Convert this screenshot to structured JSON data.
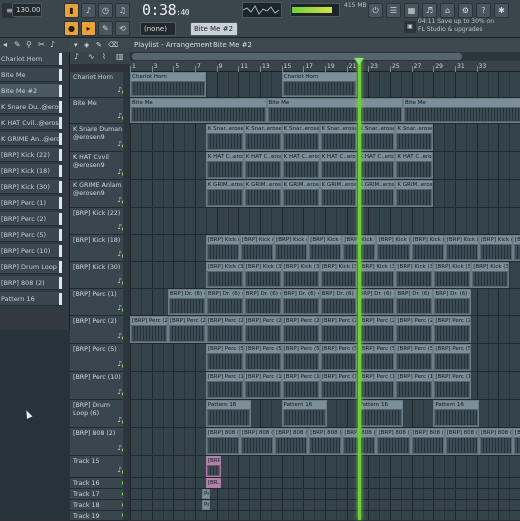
{
  "toolbar": {
    "tempo": "130.000",
    "time_main": "0:38",
    "time_sub": ":40",
    "pattern_selector": "Bite Me #2",
    "snap_selector": "(none)",
    "cpu_label": "415 MB",
    "promo_line1": "04:11  Save up to 30% on",
    "promo_line2": "FL Studio & upgrades"
  },
  "browser": {
    "items": [
      {
        "label": "Chariot Horn",
        "selected": false
      },
      {
        "label": "Bite Me",
        "selected": false
      },
      {
        "label": "Bite Me #2",
        "selected": true
      },
      {
        "label": "K Snare Du..@erosen9",
        "selected": false
      },
      {
        "label": "K HAT Cvil..@erosen9",
        "selected": false
      },
      {
        "label": "K GRIME An..@erosen9",
        "selected": false
      },
      {
        "label": "[BRP] Kick (22)",
        "selected": false
      },
      {
        "label": "[BRP] Kick (18)",
        "selected": false
      },
      {
        "label": "[BRP] Kick (30)",
        "selected": false
      },
      {
        "label": "[BRP] Perc (1)",
        "selected": false
      },
      {
        "label": "[BRP] Perc (2)",
        "selected": false
      },
      {
        "label": "[BRP] Perc (5)",
        "selected": false
      },
      {
        "label": "[BRP] Perc (10)",
        "selected": false
      },
      {
        "label": "[BRP] Drum Loop (6)",
        "selected": false
      },
      {
        "label": "[BRP] 808 (2)",
        "selected": false
      },
      {
        "label": "Pattern 16",
        "selected": false
      }
    ]
  },
  "playlist": {
    "title": "Playlist - Arrangement",
    "separator": "›",
    "pattern": "Bite Me #2",
    "ruler": [
      "1",
      "3",
      "5",
      "7",
      "9",
      "11",
      "13",
      "15",
      "17",
      "19",
      "21",
      "23",
      "25",
      "27",
      "29",
      "31",
      "33"
    ]
  },
  "tracks": [
    {
      "label": "Chariot Horn",
      "clips": [
        {
          "title": "Chariot Horn"
        },
        {
          "title": "Chariot Horn"
        }
      ]
    },
    {
      "label": "Bite Me",
      "clips": [
        {
          "title": "Bite Me"
        },
        {
          "title": "Bite Me"
        },
        {
          "title": "Bite Me"
        }
      ]
    },
    {
      "label": "K Snare Duman @erosen9",
      "clips": [
        {
          "title": "K Snar..erosen9"
        },
        {
          "title": "K Snar..erosen9"
        },
        {
          "title": "K Snar..erosen9"
        },
        {
          "title": "K Snar..erosen9"
        },
        {
          "title": "K Snar..erosen9"
        },
        {
          "title": "K Snar..erosen9"
        }
      ]
    },
    {
      "label": "K HAT Cvvil @erosen9",
      "clips": [
        {
          "title": "K HAT C..erosen9"
        },
        {
          "title": "K HAT C..erosen9"
        },
        {
          "title": "K HAT C..erosen9"
        },
        {
          "title": "K HAT C..erosen9"
        },
        {
          "title": "K HAT C..erosen9"
        },
        {
          "title": "K HAT C..erosen9"
        }
      ]
    },
    {
      "label": "K GRIME Anlam @erosen9",
      "clips": [
        {
          "title": "K GRIM..erosen9"
        },
        {
          "title": "K GRIM..erosen9"
        },
        {
          "title": "K GRIM..erosen9"
        },
        {
          "title": "K GRIM..erosen9"
        },
        {
          "title": "K GRIM..erosen9"
        },
        {
          "title": "K GRIM..erosen9"
        }
      ]
    },
    {
      "label": "[BRP] Kick (22)",
      "clips": []
    },
    {
      "label": "[BRP] Kick (18)",
      "clips": [
        {
          "title": "[BRP] Kick (18)"
        },
        {
          "title": "[BRP] Kick (18)"
        },
        {
          "title": "[BRP] Kick (18)"
        },
        {
          "title": "[BRP] Kick (18)"
        },
        {
          "title": "[BRP] Kick (18)"
        },
        {
          "title": "[BRP] Kick (18)"
        },
        {
          "title": "[BRP] Kick (18)"
        },
        {
          "title": "[BRP] Kick (18)"
        },
        {
          "title": "[BRP] Kick (18)"
        },
        {
          "title": "[BRP] Kick (18)"
        }
      ]
    },
    {
      "label": "[BRP] Kick (30)",
      "clips": [
        {
          "title": "[BRP] Kick (30)"
        },
        {
          "title": "[BRP] Kick (30)"
        },
        {
          "title": "[BRP] Kick (30)"
        },
        {
          "title": "[BRP] Kick (30)"
        },
        {
          "title": "[BRP] Kick (30)"
        },
        {
          "title": "[BRP] Kick (30)"
        },
        {
          "title": "[BRP] Kick (30)"
        },
        {
          "title": "[BRP] Kick (30)"
        }
      ]
    },
    {
      "label": "[BRP] Perc (1)",
      "clips": [
        {
          "title": "BRP] Dr. (6) #2"
        },
        {
          "title": "BRP] Dr. (6) #2"
        },
        {
          "title": "BRP] Dr. (6) #2"
        },
        {
          "title": "BRP] Dr. (6) #2"
        },
        {
          "title": "BRP] Dr. (6) #2"
        },
        {
          "title": "BRP] Dr. (6) #2"
        },
        {
          "title": "BRP] Dr. (6) #2"
        },
        {
          "title": "BRP] Dr. (6) #2"
        }
      ]
    },
    {
      "label": "[BRP] Perc (2)",
      "clips": [
        {
          "title": "[BRP] Perc (2)"
        },
        {
          "title": "[BRP] Perc (2)"
        },
        {
          "title": "[BRP] Perc (2)"
        },
        {
          "title": "[BRP] Perc (2)"
        },
        {
          "title": "[BRP] Perc (2)"
        },
        {
          "title": "[BRP] Perc (2)"
        },
        {
          "title": "[BRP] Perc (2)"
        },
        {
          "title": "[BRP] Perc (2)"
        },
        {
          "title": "[BRP] Perc (2)"
        }
      ]
    },
    {
      "label": "[BRP] Perc (5)",
      "clips": [
        {
          "title": "[BRP] Perc (5)"
        },
        {
          "title": "[BRP] Perc (5)"
        },
        {
          "title": "[BRP] Perc (5)"
        },
        {
          "title": "[BRP] Perc (5)"
        },
        {
          "title": "[BRP] Perc (5)"
        },
        {
          "title": "[BRP] Perc (5)"
        },
        {
          "title": "[BRP] Perc (5)"
        }
      ]
    },
    {
      "label": "[BRP] Perc (10)",
      "clips": [
        {
          "title": "[BRP] Perc (10)"
        },
        {
          "title": "[BRP] Perc (10)"
        },
        {
          "title": "[BRP] Perc (10)"
        },
        {
          "title": "[BRP] Perc (10)"
        },
        {
          "title": "[BRP] Perc (10)"
        },
        {
          "title": "[BRP] Perc (10)"
        },
        {
          "title": "[BRP] Perc (10)"
        }
      ]
    },
    {
      "label": "[BRP] Drum Loop (6)",
      "clips": [
        {
          "title": "Pattern 16"
        },
        {
          "title": "Pattern 16"
        },
        {
          "title": "Pattern 16"
        },
        {
          "title": "Pattern 16"
        }
      ]
    },
    {
      "label": "[BRP] 808 (2)",
      "clips": [
        {
          "title": "[BRP] 808 (2)"
        },
        {
          "title": "[BRP] 808 (2)"
        },
        {
          "title": "[BRP] 808 (2)"
        },
        {
          "title": "[BRP] 808 (2)"
        },
        {
          "title": "[BRP] 808 (2)"
        },
        {
          "title": "[BRP] 808 (2)"
        },
        {
          "title": "[BRP] 808 (2)"
        },
        {
          "title": "[BRP] 808 (2)"
        },
        {
          "title": "[BRP] 808 (2)"
        },
        {
          "title": "[BRP] 808 (2)"
        }
      ]
    },
    {
      "label": "Track 15",
      "clips": [
        {
          "title": "[BRP] Dr. (6)"
        }
      ]
    },
    {
      "label": "Track 16",
      "clips": [
        {
          "title": "[BR..(2)"
        }
      ]
    },
    {
      "label": "Track 17",
      "clips": [
        {
          "title": "Pa.."
        }
      ]
    },
    {
      "label": "Track 18",
      "clips": [
        {
          "title": "Pa.."
        }
      ]
    },
    {
      "label": "Track 19",
      "clips": []
    }
  ]
}
